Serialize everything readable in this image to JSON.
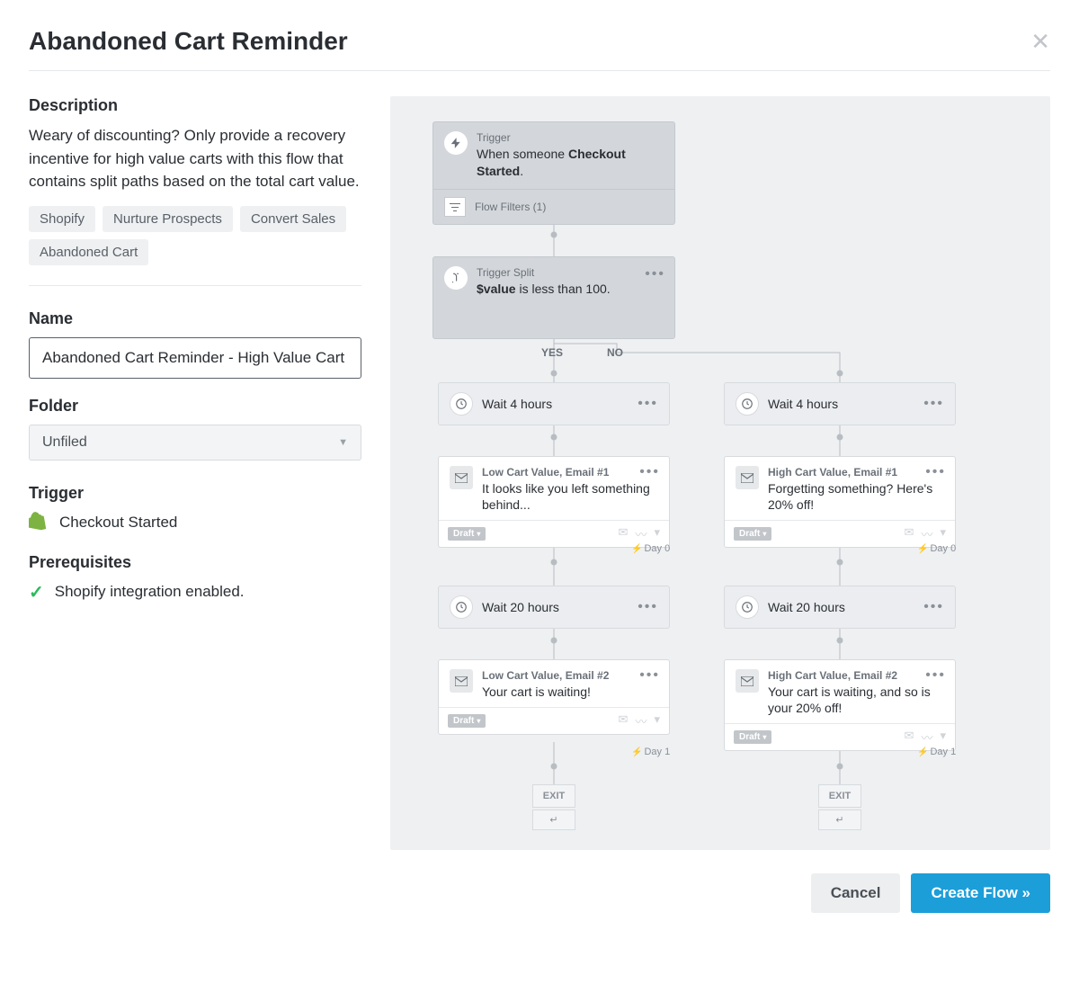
{
  "modal": {
    "title": "Abandoned Cart Reminder"
  },
  "sidebar": {
    "description_heading": "Description",
    "description_text": "Weary of discounting? Only provide a recovery incentive for high value carts with this flow that contains split paths based on the total cart value.",
    "tags": [
      "Shopify",
      "Nurture Prospects",
      "Convert Sales",
      "Abandoned Cart"
    ],
    "name_heading": "Name",
    "name_value": "Abandoned Cart Reminder - High Value Cart",
    "folder_heading": "Folder",
    "folder_value": "Unfiled",
    "trigger_heading": "Trigger",
    "trigger_text": "Checkout Started",
    "prereq_heading": "Prerequisites",
    "prereq_text": "Shopify integration enabled."
  },
  "flow": {
    "trigger": {
      "label": "Trigger",
      "text_prefix": "When someone ",
      "text_bold": "Checkout Started",
      "text_suffix": ".",
      "filters_label": "Flow Filters (1)"
    },
    "split": {
      "label": "Trigger Split",
      "cond_bold": "$value",
      "cond_rest": " is less than 100."
    },
    "branch_yes": "YES",
    "branch_no": "NO",
    "yes": {
      "wait1": "Wait 4 hours",
      "email1": {
        "label": "Low Cart Value, Email #1",
        "msg": "It looks like you left something behind...",
        "status": "Draft",
        "day": "Day 0"
      },
      "wait2": "Wait 20 hours",
      "email2": {
        "label": "Low Cart Value, Email #2",
        "msg": "Your cart is waiting!",
        "status": "Draft",
        "day": "Day 1"
      }
    },
    "no": {
      "wait1": "Wait 4 hours",
      "email1": {
        "label": "High Cart Value, Email #1",
        "msg": "Forgetting something? Here's 20% off!",
        "status": "Draft",
        "day": "Day 0"
      },
      "wait2": "Wait 20 hours",
      "email2": {
        "label": "High Cart Value, Email #2",
        "msg": "Your cart is waiting, and so is your 20% off!",
        "status": "Draft",
        "day": "Day 1"
      }
    },
    "exit": "EXIT"
  },
  "footer": {
    "cancel": "Cancel",
    "create": "Create Flow »"
  }
}
